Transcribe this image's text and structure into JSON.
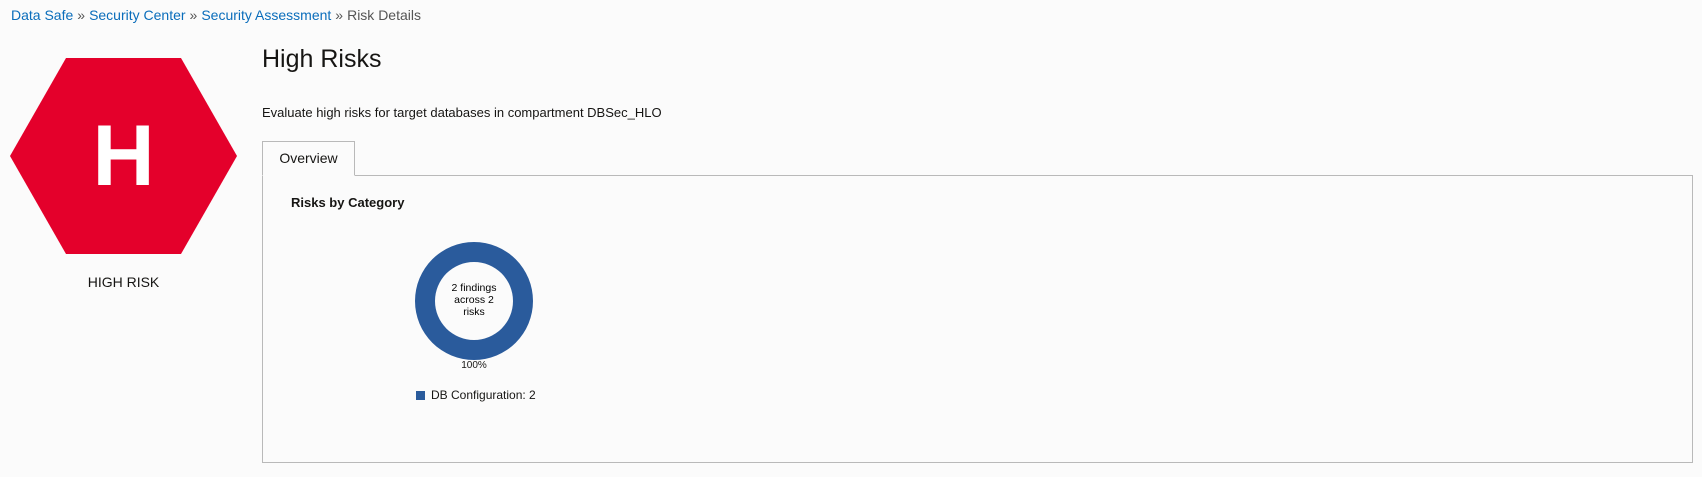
{
  "breadcrumb": {
    "items": [
      "Data Safe",
      "Security Center",
      "Security Assessment"
    ],
    "current": "Risk Details",
    "separator": "»"
  },
  "badge": {
    "letter": "H",
    "label": "HIGH RISK",
    "color": "#e4002b",
    "icon": "high-risk-hexagon-icon"
  },
  "header": {
    "title": "High Risks",
    "description": "Evaluate high risks for target databases in compartment DBSec_HLO"
  },
  "tabs": [
    {
      "label": "Overview",
      "active": true
    }
  ],
  "panel": {
    "title": "Risks by Category"
  },
  "chart_data": {
    "type": "pie",
    "donut": true,
    "title": "Risks by Category",
    "center_lines": [
      "2 findings",
      "across 2",
      "risks"
    ],
    "slices": [
      {
        "label": "DB Configuration",
        "value": 2,
        "percent": "100%",
        "color": "#2a5b9c"
      }
    ],
    "legend": [
      {
        "text": "DB Configuration: 2",
        "color": "#2a5b9c"
      }
    ],
    "legend_position": "bottom"
  }
}
